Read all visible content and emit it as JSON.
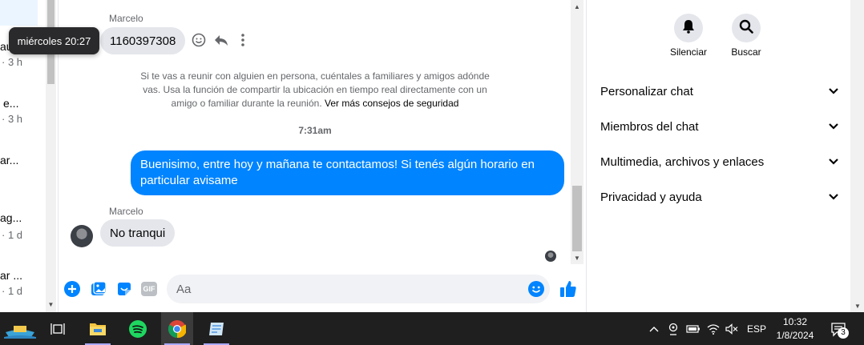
{
  "tooltip": {
    "text": "miércoles 20:27"
  },
  "conversations": [
    {
      "name": "au...",
      "time": "· 3 h"
    },
    {
      "name": "e...",
      "time": "· 3 h"
    },
    {
      "name": "ar...",
      "time": ""
    },
    {
      "name": "ag...",
      "time": "· 1 d"
    },
    {
      "name": "ar ...",
      "time": "· 1 d"
    }
  ],
  "chat": {
    "messages": [
      {
        "sender": "Marcelo",
        "text": "1160397308"
      },
      {
        "sender": "Marcelo",
        "text": "No tranqui"
      }
    ],
    "safety_notice": "Si te vas a reunir con alguien en persona, cuéntales a familiares y amigos adóndevas. Usa la función de compartir la ubicación en tiempo real directamente con un amigo o familiar durante la reunión.",
    "safety_line1": "Si te vas a reunir con alguien en persona, cuéntales a familiares y amigos adónde",
    "safety_line2": "vas. Usa la función de compartir la ubicación en tiempo real directamente con un",
    "safety_line3": "amigo o familiar durante la reunión.",
    "safety_link": "Ver más consejos de seguridad",
    "time_separator": "7:31am",
    "outgoing": "Buenisimo, entre hoy y mañana te contactamos! Si tenés algún horario en particular avisame"
  },
  "composer": {
    "placeholder": "Aa",
    "icons": [
      "plus-circle-icon",
      "image-icon",
      "sticker-icon",
      "gif-icon",
      "emoji-icon",
      "like-icon"
    ],
    "gif_label": "GIF"
  },
  "right_panel": {
    "mute_label": "Silenciar",
    "search_label": "Buscar",
    "sections": [
      {
        "label": "Personalizar chat"
      },
      {
        "label": "Miembros del chat"
      },
      {
        "label": "Multimedia, archivos y enlaces"
      },
      {
        "label": "Privacidad y ayuda"
      }
    ]
  },
  "taskbar": {
    "lang": "ESP",
    "time": "10:32",
    "date": "1/8/2024",
    "notifications": "3"
  },
  "colors": {
    "accent": "#0084ff",
    "bubble_in": "#e4e6eb",
    "taskbar": "#1f1f1f"
  }
}
